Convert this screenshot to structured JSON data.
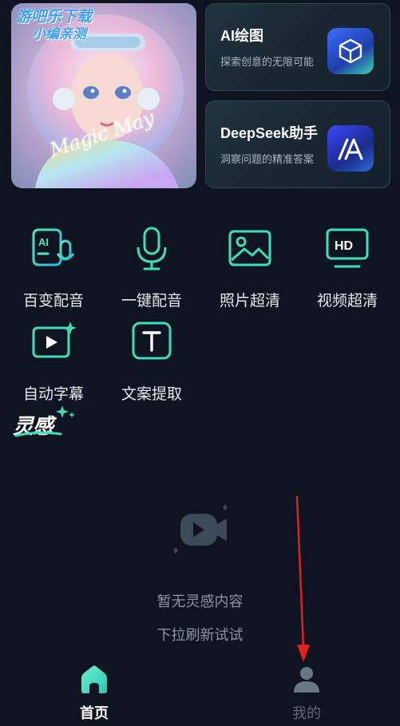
{
  "hero": {
    "watermark_line1": "游吧乐下载",
    "watermark_line2": "小编亲测",
    "signature": "Magic May"
  },
  "cards": [
    {
      "title": "AI绘图",
      "subtitle": "探索创意的无限可能",
      "icon": "cube-icon"
    },
    {
      "title": "DeepSeek助手",
      "subtitle": "洞察问题的精准答案",
      "icon": "deepseek-a-icon"
    }
  ],
  "tools": [
    {
      "label": "百变配音",
      "icon": "ai-voice-icon"
    },
    {
      "label": "一键配音",
      "icon": "microphone-icon"
    },
    {
      "label": "照片超清",
      "icon": "image-icon"
    },
    {
      "label": "视频超清",
      "icon": "hd-icon"
    },
    {
      "label": "自动字幕",
      "icon": "video-subtitle-icon"
    },
    {
      "label": "文案提取",
      "icon": "text-extract-icon"
    }
  ],
  "inspiration": {
    "section_title": "灵感",
    "empty_line1": "暂无灵感内容",
    "empty_line2": "下拉刷新试试"
  },
  "nav": {
    "home_label": "首页",
    "mine_label": "我的"
  },
  "colors": {
    "background": "#0f1520",
    "accent": "#3be0b8",
    "annotation_arrow": "#e02020"
  }
}
